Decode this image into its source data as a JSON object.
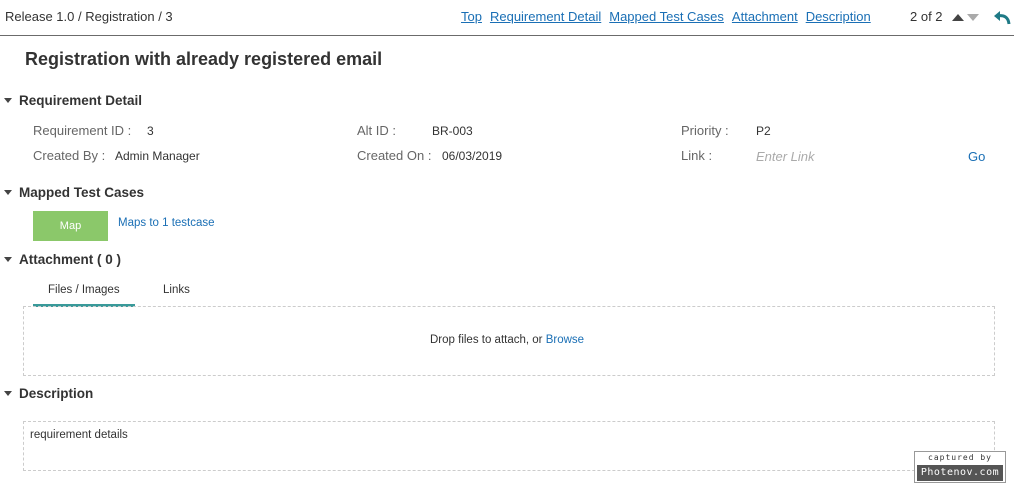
{
  "header": {
    "breadcrumb": "Release 1.0 / Registration / 3",
    "links": [
      "Top",
      "Requirement Detail",
      "Mapped Test Cases",
      "Attachment",
      "Description"
    ],
    "pager": "2 of 2"
  },
  "title": "Registration with already registered email",
  "requirement_detail": {
    "heading": "Requirement Detail",
    "requirement_id_label": "Requirement ID :",
    "requirement_id": "3",
    "alt_id_label": "Alt ID :",
    "alt_id": "BR-003",
    "priority_label": "Priority :",
    "priority": "P2",
    "created_by_label": "Created By :",
    "created_by": "Admin Manager",
    "created_on_label": "Created On :",
    "created_on": "06/03/2019",
    "link_label": "Link :",
    "link_placeholder": "Enter Link",
    "go_label": "Go"
  },
  "mapped_test_cases": {
    "heading": "Mapped Test Cases",
    "map_button": "Map",
    "maps_text": "Maps to 1 testcase"
  },
  "attachment": {
    "heading": "Attachment ( 0 )",
    "tabs": [
      "Files / Images",
      "Links"
    ],
    "drop_text": "Drop files to attach, or ",
    "browse": "Browse"
  },
  "description": {
    "heading": "Description",
    "text": "requirement details"
  },
  "watermark": {
    "top": "captured by",
    "bottom": "Photenov.com"
  },
  "colors": {
    "link": "#1a6fb5",
    "map_button": "#8bc86a",
    "active_tab": "#3a9a9a"
  }
}
